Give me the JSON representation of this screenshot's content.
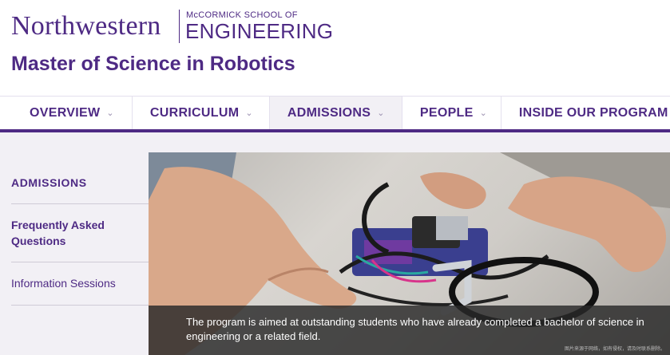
{
  "header": {
    "wordmark": "Northwestern",
    "school_line": "McCORMICK SCHOOL OF",
    "school_name": "ENGINEERING",
    "site_title": "Master of Science in Robotics"
  },
  "nav": {
    "tabs": [
      {
        "label": "OVERVIEW",
        "has_dropdown": true,
        "active": false
      },
      {
        "label": "CURRICULUM",
        "has_dropdown": true,
        "active": false
      },
      {
        "label": "ADMISSIONS",
        "has_dropdown": true,
        "active": true
      },
      {
        "label": "PEOPLE",
        "has_dropdown": true,
        "active": false
      },
      {
        "label": "INSIDE OUR PROGRAM",
        "has_dropdown": false,
        "active": false
      }
    ],
    "dropdown_icon": "chevron-down-icon"
  },
  "sidebar": {
    "heading": "ADMISSIONS",
    "items": [
      {
        "label": "Frequently Asked Questions"
      },
      {
        "label": "Information Sessions"
      }
    ]
  },
  "hero": {
    "caption": "The program is aimed at outstanding students who have already completed a bachelor of science in engineering or a related field.",
    "watermark": "图片来源于网络，如有侵权，请及时联系删除。"
  },
  "colors": {
    "brand_purple": "#4e2a84",
    "light_bg": "#f2f0f5",
    "caption_bg": "#282828"
  }
}
